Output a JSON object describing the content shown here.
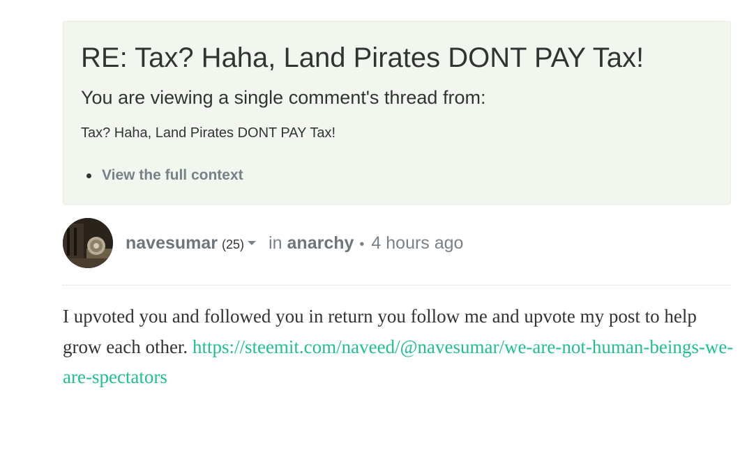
{
  "context": {
    "title": "RE: Tax? Haha, Land Pirates DONT PAY Tax!",
    "subtitle": "You are viewing a single comment's thread from:",
    "parent_post": "Tax? Haha, Land Pirates DONT PAY Tax!",
    "full_context_link": "View the full context"
  },
  "comment": {
    "author": "navesumar",
    "reputation": "(25)",
    "in_label": "in",
    "category": "anarchy",
    "separator": "•",
    "timestamp": "4 hours ago",
    "body_text": "I upvoted you and followed you in return you follow me and upvote my post to help grow each other. ",
    "link_text": "https://steemit.com/naveed/@navesumar/we-are-not-human-beings-we-are-spectators"
  },
  "colors": {
    "context_background": "#f1f7ee",
    "link_accent": "#1fbf8f",
    "muted_text": "#788187",
    "body_text": "#333333"
  },
  "icons": {
    "author_menu": "chevron-down-icon",
    "avatar": "user-avatar"
  }
}
